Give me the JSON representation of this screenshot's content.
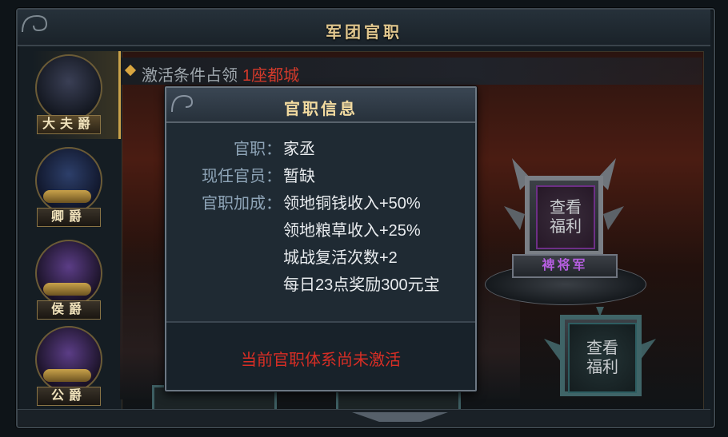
{
  "window": {
    "title": "军团官职"
  },
  "condition": {
    "label": "激活条件占领",
    "value": "1座都城"
  },
  "tabs": [
    {
      "label": "大夫爵",
      "active": true
    },
    {
      "label": "卿爵",
      "active": false
    },
    {
      "label": "侯爵",
      "active": false
    },
    {
      "label": "公爵",
      "active": false
    }
  ],
  "pedestals": [
    {
      "button_line1": "查看",
      "button_line2": "福利",
      "plaque": "裨将军"
    },
    {
      "button_line1": "查看",
      "button_line2": "福利"
    }
  ],
  "popup": {
    "title": "官职信息",
    "post_label": "官职：",
    "post_value": "家丞",
    "holder_label": "现任官员：",
    "holder_value": "暂缺",
    "bonus_label": "官职加成：",
    "bonuses": [
      "领地铜钱收入+50%",
      "领地粮草收入+25%",
      "城战复活次数+2",
      "每日23点奖励300元宝"
    ],
    "status": "当前官职体系尚未激活"
  },
  "colors": {
    "accent_gold": "#e2c88f",
    "alert_red": "#d82e25",
    "condition_red": "#d33a2b",
    "plaque_purple": "#b65ee0"
  }
}
